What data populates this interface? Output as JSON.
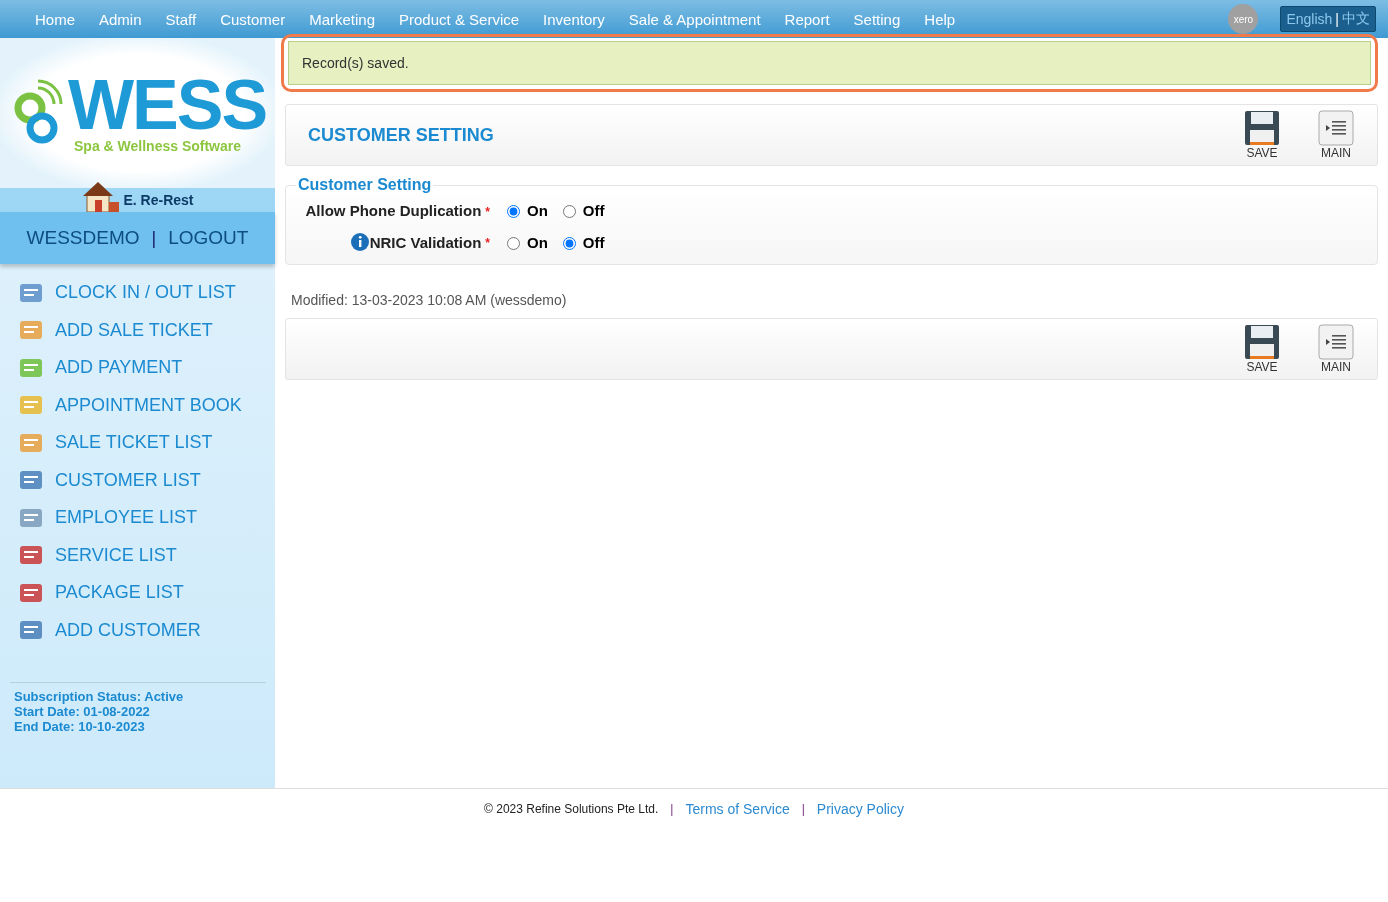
{
  "nav": {
    "items": [
      "Home",
      "Admin",
      "Staff",
      "Customer",
      "Marketing",
      "Product & Service",
      "Inventory",
      "Sale & Appointment",
      "Report",
      "Setting",
      "Help"
    ],
    "xero": "xero",
    "languages": [
      "English",
      "中文"
    ],
    "separator": "|"
  },
  "sidebar": {
    "logo": {
      "title": "WESS",
      "tagline": "Spa & Wellness Software"
    },
    "branch": "E. Re-Rest",
    "user": "WESSDEMO",
    "logout": "LOGOUT",
    "separator": "|",
    "menu": [
      "CLOCK IN / OUT LIST",
      "ADD SALE TICKET",
      "ADD PAYMENT",
      "APPOINTMENT BOOK",
      "SALE TICKET LIST",
      "CUSTOMER LIST",
      "EMPLOYEE LIST",
      "SERVICE LIST",
      "PACKAGE LIST",
      "ADD CUSTOMER"
    ],
    "subscription": [
      "Subscription Status: Active",
      "Start Date: 01-08-2022",
      "End Date: 10-10-2023"
    ]
  },
  "alert": "Record(s) saved.",
  "header": {
    "title": "CUSTOMER SETTING",
    "buttons": [
      "SAVE",
      "MAIN"
    ]
  },
  "section": {
    "title": "Customer Setting",
    "fields": [
      {
        "label": "Allow Phone Duplication",
        "required": "*",
        "info": false,
        "options": [
          {
            "label": "On",
            "selected": true
          },
          {
            "label": "Off",
            "selected": false
          }
        ]
      },
      {
        "label": "NRIC Validation",
        "required": "*",
        "info": true,
        "options": [
          {
            "label": "On",
            "selected": false
          },
          {
            "label": "Off",
            "selected": true
          }
        ]
      }
    ]
  },
  "modified": "Modified: 13-03-2023 10:08 AM (wessdemo)",
  "footer_buttons": [
    "SAVE",
    "MAIN"
  ],
  "footer": {
    "copyright": "© 2023 Refine Solutions Pte Ltd.",
    "links": [
      "Terms of Service",
      "Privacy Policy"
    ],
    "separators": [
      "|",
      "|"
    ]
  }
}
